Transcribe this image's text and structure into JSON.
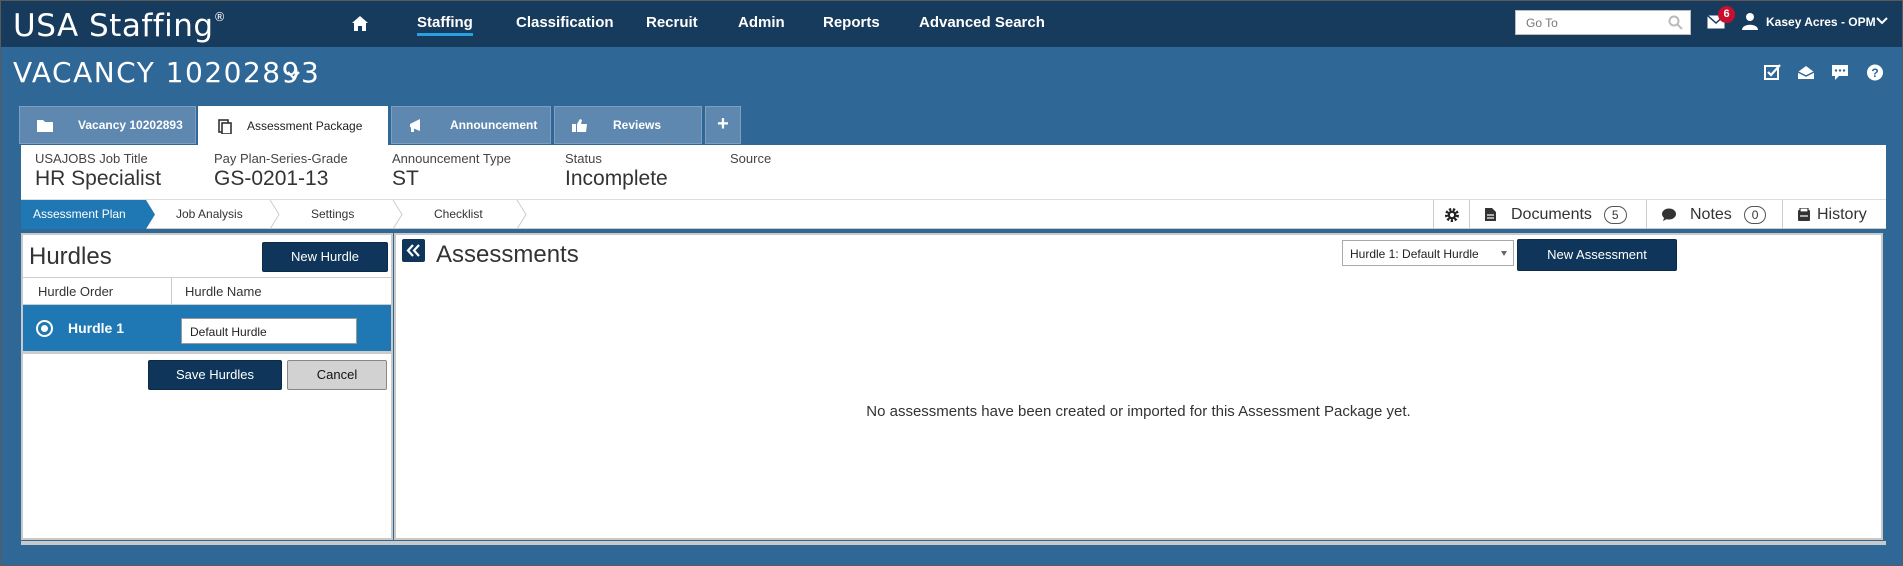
{
  "app": {
    "logo": "USA Staffing",
    "logo_mark": "®"
  },
  "nav": {
    "items": [
      "Staffing",
      "Classification",
      "Recruit",
      "Admin",
      "Reports",
      "Advanced Search"
    ],
    "active": "Staffing"
  },
  "search": {
    "placeholder": "Go To"
  },
  "notifications": {
    "count": "6"
  },
  "user": {
    "name": "Kasey Acres - OPM"
  },
  "vacancy": {
    "title": "VACANCY 10202893"
  },
  "tabs": [
    {
      "label": "Vacancy 10202893",
      "icon": "folder-icon"
    },
    {
      "label": "Assessment Package",
      "icon": "documents-icon"
    },
    {
      "label": "Announcement",
      "icon": "megaphone-icon"
    },
    {
      "label": "Reviews",
      "icon": "thumbs-up-icon"
    }
  ],
  "info": {
    "job_title_label": "USAJOBS Job Title",
    "job_title": "HR Specialist",
    "grade_label": "Pay Plan-Series-Grade",
    "grade": "GS-0201-13",
    "ann_type_label": "Announcement Type",
    "ann_type": "ST",
    "status_label": "Status",
    "status": "Incomplete",
    "source_label": "Source",
    "source": ""
  },
  "steps": [
    "Assessment Plan",
    "Job Analysis",
    "Settings",
    "Checklist"
  ],
  "tools": {
    "documents_label": "Documents",
    "documents_count": "5",
    "notes_label": "Notes",
    "notes_count": "0",
    "history_label": "History"
  },
  "hurdles": {
    "title": "Hurdles",
    "new_button": "New Hurdle",
    "col_order": "Hurdle Order",
    "col_name": "Hurdle Name",
    "rows": [
      {
        "order": "Hurdle 1",
        "name": "Default Hurdle"
      }
    ],
    "save_button": "Save Hurdles",
    "cancel_button": "Cancel"
  },
  "assessments": {
    "title": "Assessments",
    "hurdle_select": "Hurdle 1: Default Hurdle",
    "new_button": "New Assessment",
    "empty_message": "No assessments have been created or imported for this Assessment Package yet."
  },
  "colors": {
    "nav_bg": "#173b5c",
    "page_bg": "#2f6797",
    "accent": "#1f78b4",
    "button_dark": "#0f365a",
    "badge": "#c8102e"
  }
}
